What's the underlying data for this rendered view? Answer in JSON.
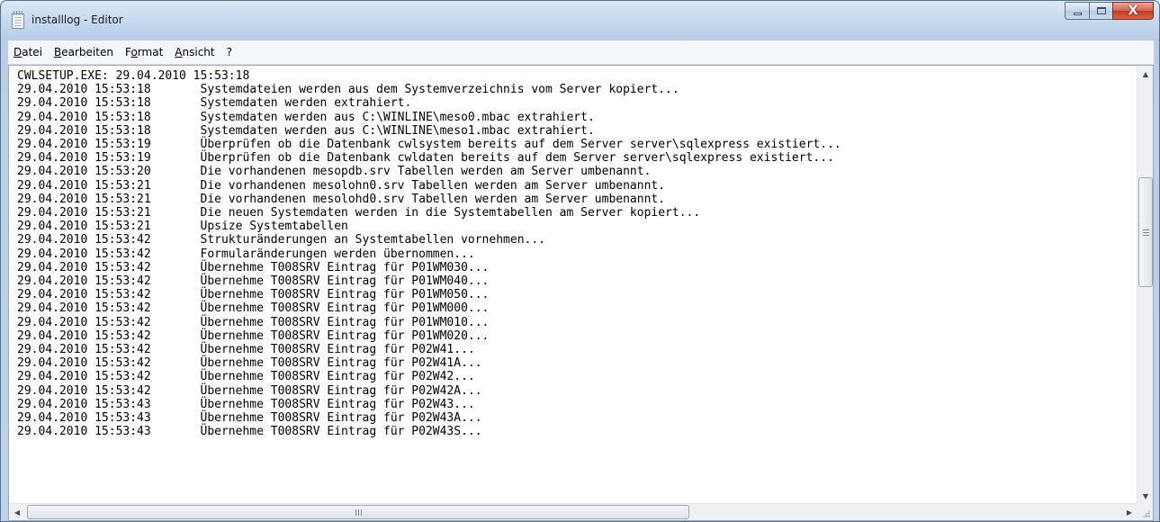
{
  "window": {
    "title": "installlog - Editor",
    "icon": "notepad-icon",
    "buttons": {
      "minimize": "minimize-icon",
      "maximize": "maximize-icon",
      "close": "X"
    }
  },
  "menu": [
    {
      "label": "Datei",
      "accel": "D"
    },
    {
      "label": "Bearbeiten",
      "accel": "B"
    },
    {
      "label": "Format",
      "accel": "o"
    },
    {
      "label": "Ansicht",
      "accel": "A"
    },
    {
      "label": "?",
      "accel": "?"
    }
  ],
  "editor": {
    "lines": [
      "CWLSETUP.EXE: 29.04.2010 15:53:18",
      "29.04.2010 15:53:18       Systemdateien werden aus dem Systemverzeichnis vom Server kopiert...",
      "29.04.2010 15:53:18       Systemdaten werden extrahiert.",
      "29.04.2010 15:53:18       Systemdaten werden aus C:\\WINLINE\\meso0.mbac extrahiert.",
      "29.04.2010 15:53:18       Systemdaten werden aus C:\\WINLINE\\meso1.mbac extrahiert.",
      "29.04.2010 15:53:19       Überprüfen ob die Datenbank cwlsystem bereits auf dem Server server\\sqlexpress existiert...",
      "29.04.2010 15:53:19       Überprüfen ob die Datenbank cwldaten bereits auf dem Server server\\sqlexpress existiert...",
      "29.04.2010 15:53:20       Die vorhandenen mesopdb.srv Tabellen werden am Server umbenannt.",
      "29.04.2010 15:53:21       Die vorhandenen mesolohn0.srv Tabellen werden am Server umbenannt.",
      "29.04.2010 15:53:21       Die vorhandenen mesolohd0.srv Tabellen werden am Server umbenannt.",
      "29.04.2010 15:53:21       Die neuen Systemdaten werden in die Systemtabellen am Server kopiert...",
      "29.04.2010 15:53:21       Upsize Systemtabellen",
      "29.04.2010 15:53:42       Strukturänderungen an Systemtabellen vornehmen...",
      "29.04.2010 15:53:42       Formularänderungen werden übernommen...",
      "29.04.2010 15:53:42       Übernehme T008SRV Eintrag für P01WM030...",
      "29.04.2010 15:53:42       Übernehme T008SRV Eintrag für P01WM040...",
      "29.04.2010 15:53:42       Übernehme T008SRV Eintrag für P01WM050...",
      "29.04.2010 15:53:42       Übernehme T008SRV Eintrag für P01WM000...",
      "29.04.2010 15:53:42       Übernehme T008SRV Eintrag für P01WM010...",
      "29.04.2010 15:53:42       Übernehme T008SRV Eintrag für P01WM020...",
      "29.04.2010 15:53:42       Übernehme T008SRV Eintrag für P02W41...",
      "29.04.2010 15:53:42       Übernehme T008SRV Eintrag für P02W41A...",
      "29.04.2010 15:53:42       Übernehme T008SRV Eintrag für P02W42...",
      "29.04.2010 15:53:42       Übernehme T008SRV Eintrag für P02W42A...",
      "29.04.2010 15:53:43       Übernehme T008SRV Eintrag für P02W43...",
      "29.04.2010 15:53:43       Übernehme T008SRV Eintrag für P02W43A...",
      "29.04.2010 15:53:43       Übernehme T008SRV Eintrag für P02W43S..."
    ]
  },
  "scrollbars": {
    "vertical": {
      "up_icon": "arrow-up-icon",
      "down_icon": "arrow-down-icon",
      "up": "▲",
      "down": "▼"
    },
    "horizontal": {
      "left_icon": "arrow-left-icon",
      "right_icon": "arrow-right-icon",
      "left": "◀",
      "right": "▶"
    }
  }
}
